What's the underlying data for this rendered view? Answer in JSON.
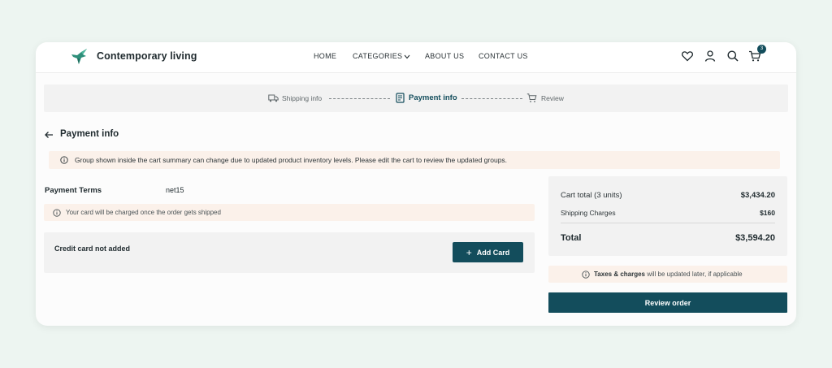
{
  "brand": {
    "name": "Contemporary living",
    "logo_icon": "hummingbird-icon"
  },
  "nav": {
    "home": "HOME",
    "categories": "CATEGORIES",
    "about": "ABOUT US",
    "contact": "CONTACT US"
  },
  "header_icons": {
    "wishlist": "heart-icon",
    "account": "user-icon",
    "search": "search-icon",
    "cart": "cart-icon",
    "cart_count": "3"
  },
  "steps": [
    {
      "label": "Shipping info",
      "icon": "truck-icon"
    },
    {
      "label": "Payment info",
      "icon": "receipt-icon"
    },
    {
      "label": "Review",
      "icon": "cart-icon"
    }
  ],
  "page_title": "Payment info",
  "notice": "Group shown inside the cart summary can change due to updated product inventory levels. Please edit the cart to review the updated groups.",
  "payment_terms": {
    "label": "Payment Terms",
    "value": "net15"
  },
  "charge_note": "Your card will be charged once the order gets shipped",
  "card": {
    "status": "Credit card not added",
    "add_label": "Add Card"
  },
  "summary": {
    "cart_total_label": "Cart total (3 units)",
    "cart_total_value": "$3,434.20",
    "shipping_label": "Shipping Charges",
    "shipping_value": "$160",
    "total_label": "Total",
    "total_value": "$3,594.20"
  },
  "tax_note": {
    "bold": "Taxes & charges",
    "rest": " will be updated later, if applicable"
  },
  "review_button": "Review order",
  "colors": {
    "accent": "#134d5c",
    "notice_bg": "#fbf1ea",
    "panel_bg": "#f2f2f2",
    "page_bg": "#edf5f1"
  }
}
